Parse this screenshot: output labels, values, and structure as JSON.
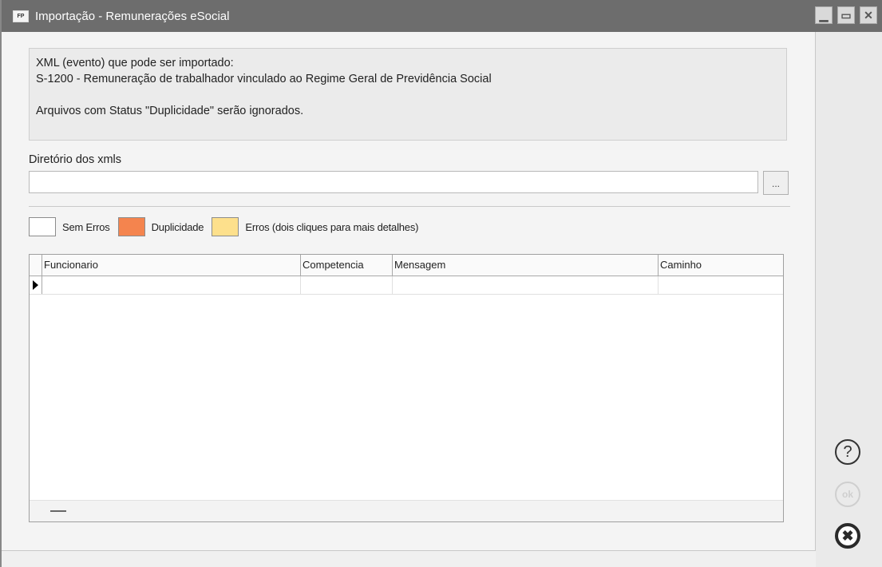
{
  "window": {
    "icon_text": "FP",
    "title": "Importação - Remunerações eSocial",
    "controls": {
      "minimize": "▁",
      "maximize": "▭",
      "close": "✕"
    }
  },
  "info": {
    "line1": "XML (evento) que pode ser importado:",
    "line2": "S-1200 - Remuneração de trabalhador vinculado ao Regime Geral de Previdência Social",
    "line3": "Arquivos com Status \"Duplicidade\" serão ignorados."
  },
  "directory": {
    "label": "Diretório dos xmls",
    "value": "",
    "browse_label": "..."
  },
  "legend": [
    {
      "label": "Sem Erros",
      "color": "#ffffff"
    },
    {
      "label": "Duplicidade",
      "color": "#f4844e"
    },
    {
      "label": "Erros (dois cliques para mais detalhes)",
      "color": "#fde08c"
    }
  ],
  "grid": {
    "columns": [
      "Funcionario",
      "Competencia",
      "Mensagem",
      "Caminho"
    ]
  },
  "buttons": {
    "help": "?",
    "ok": "ok",
    "cancel": "✖"
  }
}
